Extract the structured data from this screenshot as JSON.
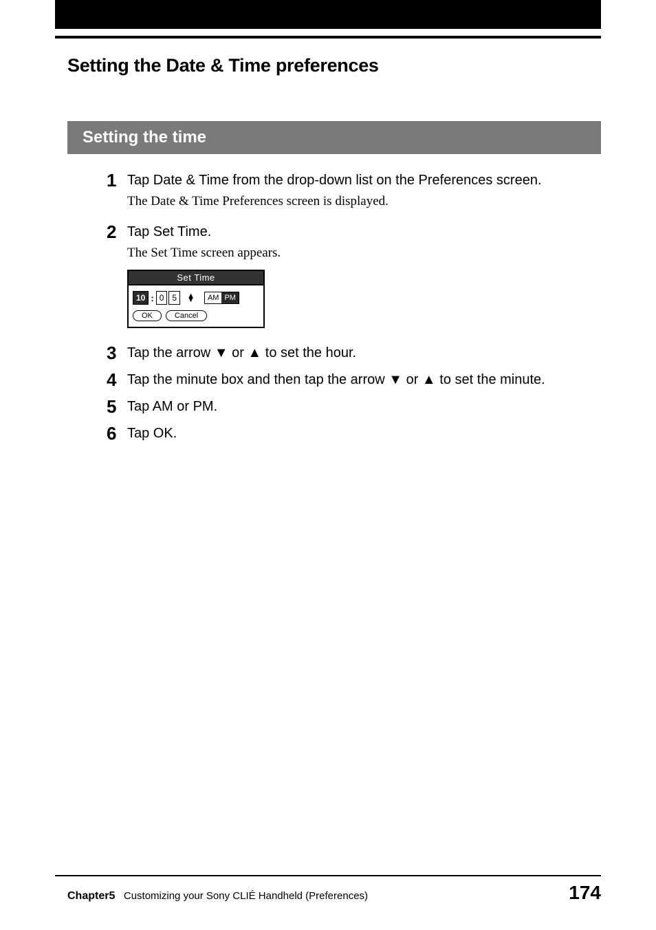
{
  "header": {
    "title": "Setting the Date & Time preferences"
  },
  "subheading": "Setting the time",
  "steps": [
    {
      "num": "1",
      "main": "Tap Date & Time from the drop-down list on the Preferences screen.",
      "sub": "The Date & Time Preferences screen is displayed."
    },
    {
      "num": "2",
      "main": "Tap Set Time.",
      "sub": "The Set Time screen appears.",
      "has_dialog": true
    },
    {
      "num": "3",
      "main": "Tap the arrow ▼ or ▲ to set the hour."
    },
    {
      "num": "4",
      "main": "Tap the minute box and then tap the arrow ▼ or ▲ to set the minute."
    },
    {
      "num": "5",
      "main": "Tap AM or PM."
    },
    {
      "num": "6",
      "main": "Tap OK."
    }
  ],
  "dialog": {
    "title": "Set Time",
    "hour": "10",
    "min_tens": "0",
    "min_ones": "5",
    "am": "AM",
    "pm": "PM",
    "ok": "OK",
    "cancel": "Cancel"
  },
  "footer": {
    "chapter_label": "Chapter5",
    "chapter_title": "Customizing your Sony CLIÉ Handheld (Preferences)",
    "page_number": "174"
  }
}
